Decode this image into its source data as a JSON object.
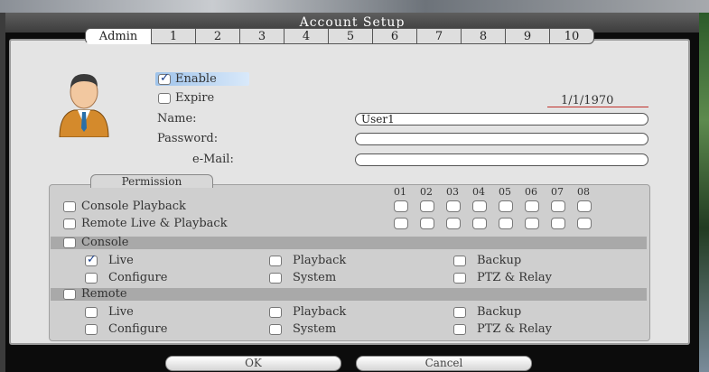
{
  "window": {
    "title": "Account Setup"
  },
  "tabs": [
    {
      "label": "Admin",
      "active": true
    },
    {
      "label": "1"
    },
    {
      "label": "2"
    },
    {
      "label": "3"
    },
    {
      "label": "4"
    },
    {
      "label": "5"
    },
    {
      "label": "6"
    },
    {
      "label": "7"
    },
    {
      "label": "8"
    },
    {
      "label": "9"
    },
    {
      "label": "10"
    }
  ],
  "account": {
    "enable_label": "Enable",
    "enable_checked": true,
    "expire_label": "Expire",
    "expire_checked": false,
    "expire_date": "1/1/1970",
    "name_label": "Name:",
    "name_value": "User1",
    "password_label": "Password:",
    "password_value": "",
    "email_label": "e-Mail:",
    "email_value": ""
  },
  "permission": {
    "title": "Permission",
    "channels": [
      "01",
      "02",
      "03",
      "04",
      "05",
      "06",
      "07",
      "08"
    ],
    "console_playback_label": "Console Playback",
    "remote_live_playback_label": "Remote Live & Playback",
    "console": {
      "label": "Console",
      "live": "Live",
      "live_checked": true,
      "playback": "Playback",
      "backup": "Backup",
      "configure": "Configure",
      "system": "System",
      "ptz_relay": "PTZ & Relay"
    },
    "remote": {
      "label": "Remote",
      "live": "Live",
      "playback": "Playback",
      "backup": "Backup",
      "configure": "Configure",
      "system": "System",
      "ptz_relay": "PTZ & Relay"
    }
  },
  "buttons": {
    "ok": "OK",
    "cancel": "Cancel"
  },
  "icons": {
    "avatar": "user-avatar-icon",
    "check": "check-icon"
  }
}
